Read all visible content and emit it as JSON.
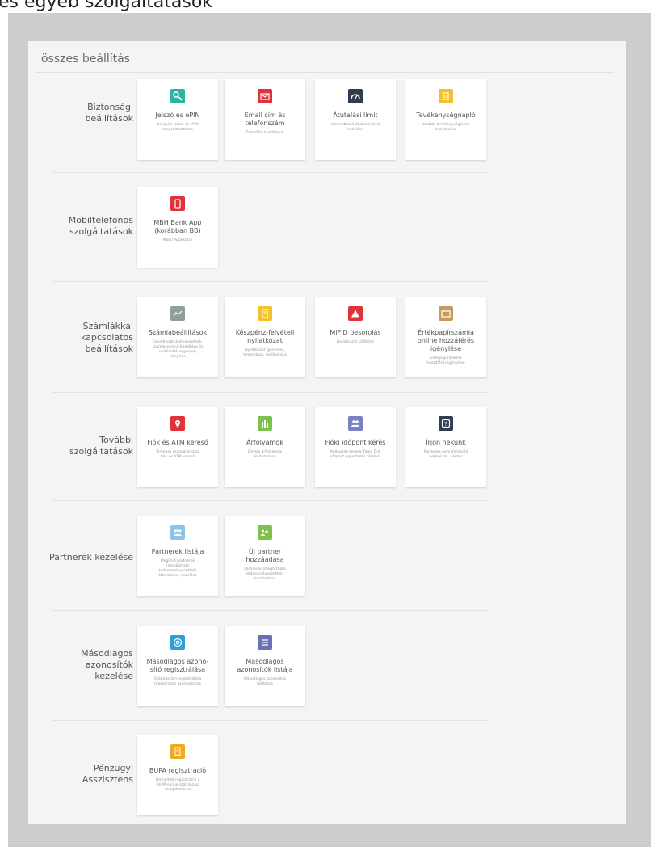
{
  "top_title": "és egyéb szolgáltatások",
  "panel_title": "összes beállítás",
  "sections": [
    {
      "label": "Biztonsági\nbeállítások",
      "cards": [
        {
          "title": "Jelszó és ePIN",
          "desc": "Belépési jelszó és ePIN\nmegváltoztatása",
          "icon": "key-icon",
          "color": "#2bb5a0"
        },
        {
          "title": "Email cím és\ntelefonszám",
          "desc": "Értesítési beállítások",
          "icon": "envelope-icon",
          "color": "#e0323a"
        },
        {
          "title": "Átutalási limit",
          "desc": "Internetbank átutalási limit\nkezelése",
          "icon": "gauge-icon",
          "color": "#2e3e4f"
        },
        {
          "title": "Tevékenységnapló",
          "desc": "Korábbi tevékenységeinek\nlekérdezése",
          "icon": "log-icon",
          "color": "#f2c12e"
        }
      ]
    },
    {
      "label": "Mobiltelefonos\nszolgáltatások",
      "cards": [
        {
          "title": "MBH Bank App\n(korábban BB)",
          "desc": "Mobil Applikáció",
          "icon": "phone-icon",
          "color": "#e0323a"
        }
      ]
    },
    {
      "label": "Számlákkal\nkapcsolatos\nbeállítások",
      "cards": [
        {
          "title": "Számlabeállítások",
          "desc": "Egyedi számlaelnevezések,\nszámlasorrend beállítása és\nnyitóoldali egyenleg\nelrejtése",
          "icon": "chart-icon",
          "color": "#8e9f95"
        },
        {
          "title": "Készpénz-felvételi\nnyilatkozat",
          "desc": "Nyilatkozat igénylése,\nlemondása, módosítása",
          "icon": "document-icon",
          "color": "#f2c12e"
        },
        {
          "title": "MiFID besorolás",
          "desc": "Nyilatkozat kitöltése",
          "icon": "warning-icon",
          "color": "#e0323a"
        },
        {
          "title": "Értékpapírszámla\nonline hozzáférés\nigénylése",
          "desc": "Értékpapírszámla\nhozzáférés igénylése",
          "icon": "wallet-icon",
          "color": "#c99a5a"
        }
      ]
    },
    {
      "label": "További\nszolgáltatások",
      "cards": [
        {
          "title": "Fiók és ATM kereső",
          "desc": "Térképes magyarországi\nfiók és ATM kereső",
          "icon": "map-pin-icon",
          "color": "#e0323a"
        },
        {
          "title": "Árfolyamok",
          "desc": "Deviza árfolyamok\nlekérdezése",
          "icon": "bar-chart-icon",
          "color": "#7cc24a"
        },
        {
          "title": "Fióki időpont kérés",
          "desc": "Kollégánk keresni fogja Önt\nidőpont egyeztetés céljából",
          "icon": "people-icon",
          "color": "#7b7fc4"
        },
        {
          "title": "Írjon nekünk",
          "desc": "Panaszok nem minősülő\nbejelentés, kérdés",
          "icon": "question-icon",
          "color": "#2e3e4f"
        }
      ]
    },
    {
      "label": "Partnerek kezelése",
      "cards": [
        {
          "title": "Partnerek listája",
          "desc": "Meglévő partnerek\n(megbízható\nkedvezményezettek)\náttekintése, kezelése",
          "icon": "partners-icon",
          "color": "#8fc2e8"
        },
        {
          "title": "Új partner\nhozzáadása",
          "desc": "Partnerek (megbízható\nkedvezményezettek)\nhozzáadása",
          "icon": "add-partner-icon",
          "color": "#7cc24a"
        }
      ]
    },
    {
      "label": "Másodlagos\nazonosítók\nkezelése",
      "cards": [
        {
          "title": "Másodlagos azono-\nsító regisztrálása",
          "desc": "Számlaszám regisztrálása\nmásodlagos azonosítóhoz",
          "icon": "at-icon",
          "color": "#2a9fd8"
        },
        {
          "title": "Másodlagos\nazonosítók listája",
          "desc": "Másodlagos azonosítók\nlistázása",
          "icon": "list-icon",
          "color": "#6a6fb8"
        }
      ]
    },
    {
      "label": "Pénzügyi\nAsszisztens",
      "cards": [
        {
          "title": "BUPA regisztráció",
          "desc": "Könnyített regisztráció a\nBUPA online számlázási\nszolgáltatásba",
          "icon": "receipt-icon",
          "color": "#f2a91d"
        }
      ]
    }
  ]
}
